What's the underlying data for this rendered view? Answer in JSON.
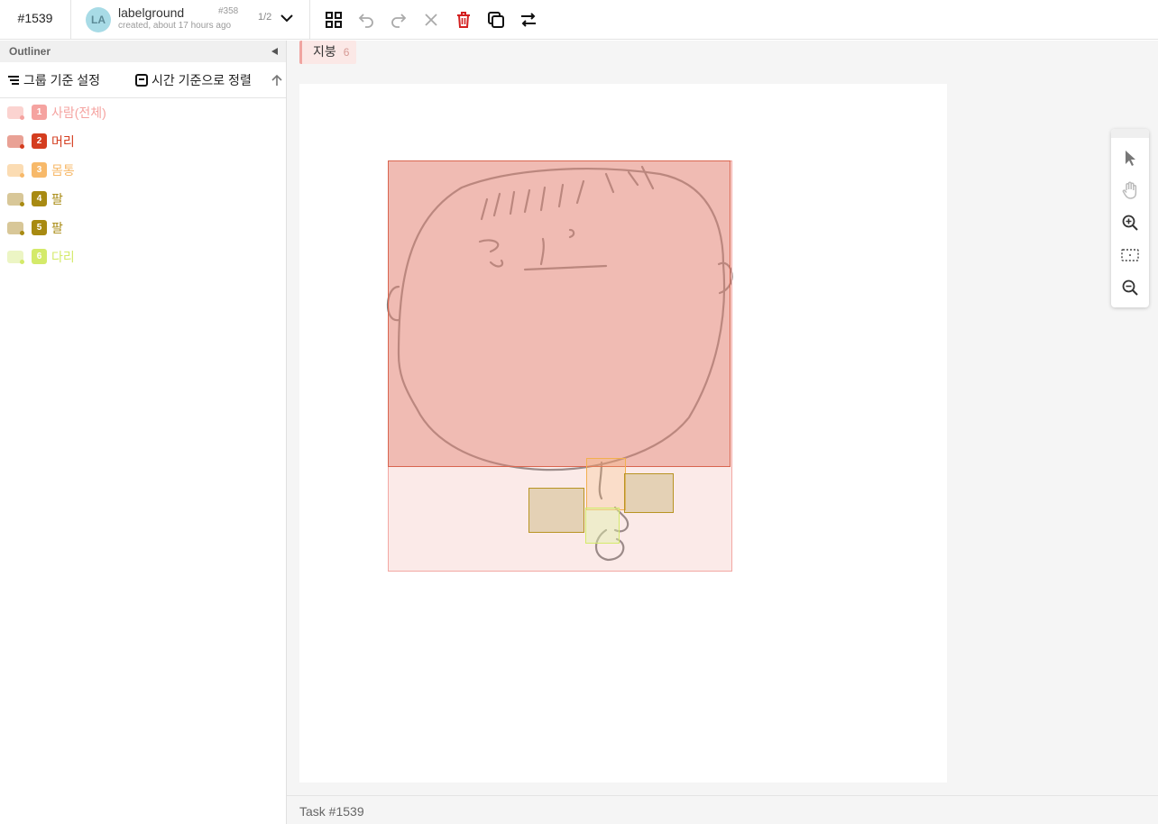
{
  "header": {
    "task_id": "#1539",
    "user": {
      "initials": "LA",
      "name": "labelground",
      "created": "created, about 17 hours ago",
      "id": "#358",
      "page": "1/2"
    },
    "tools": [
      "grid-icon",
      "undo-icon",
      "redo-icon",
      "close-icon",
      "delete-icon",
      "copy-icon",
      "swap-icon"
    ]
  },
  "sidebar": {
    "title": "Outliner",
    "group_label": "그룹 기준 설정",
    "sort_label": "시간 기준으로 정렬",
    "objects": [
      {
        "num": "1",
        "label": "사람(전체)",
        "color": "#f5a3a0",
        "thumb": "#fbd3d0"
      },
      {
        "num": "2",
        "label": "머리",
        "color": "#d43d1f",
        "thumb": "#e9a195"
      },
      {
        "num": "3",
        "label": "몸통",
        "color": "#f7b96a",
        "thumb": "#fbdcb3"
      },
      {
        "num": "4",
        "label": "팔",
        "color": "#a88a12",
        "thumb": "#d8c798"
      },
      {
        "num": "5",
        "label": "팔",
        "color": "#a88a12",
        "thumb": "#d8c798"
      },
      {
        "num": "6",
        "label": "다리",
        "color": "#d4ea6a",
        "thumb": "#ecf5c4"
      }
    ]
  },
  "main": {
    "class_name": "지붕",
    "class_count": "6",
    "footer": "Task #1539",
    "vtools": [
      "pointer-icon",
      "hand-icon",
      "zoom-in-icon",
      "fit-icon",
      "zoom-out-icon"
    ]
  }
}
